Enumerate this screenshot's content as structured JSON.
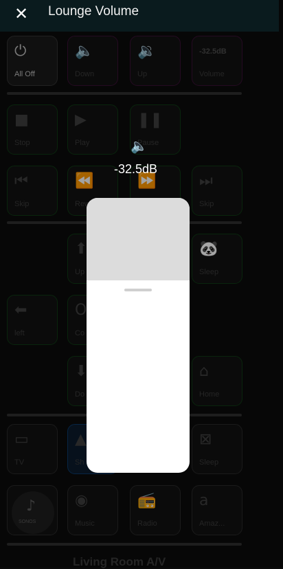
{
  "header": {
    "title": "Lounge Volume",
    "close_icon": "close-icon"
  },
  "volume": {
    "readout": "-32.5dB",
    "icon": "speaker-icon",
    "level_fraction": 0.3,
    "accent_color": "#e8b21a"
  },
  "tiles": {
    "all_off": {
      "label": "All Off",
      "icon": "power-icon"
    },
    "vol_down": {
      "label": "Down",
      "icon": "volume-down-icon"
    },
    "vol_up": {
      "label": "Up",
      "icon": "volume-up-icon"
    },
    "volume": {
      "label": "Volume",
      "value": "-32.5dB"
    },
    "stop": {
      "label": "Stop",
      "icon": "stop-icon"
    },
    "play": {
      "label": "Play",
      "icon": "play-icon"
    },
    "pause": {
      "label": "Pause",
      "icon": "pause-icon"
    },
    "skip_prev": {
      "label": "Skip",
      "icon": "skip-previous-icon"
    },
    "rewind": {
      "label": "Rew",
      "icon": "rewind-icon"
    },
    "fast_forward": {
      "label": "",
      "icon": "fast-forward-icon"
    },
    "skip_next": {
      "label": "Skip",
      "icon": "skip-next-icon"
    },
    "nav_up": {
      "label": "Up",
      "icon": "arrow-up-icon"
    },
    "sleep": {
      "label": "Sleep",
      "icon": "panda-icon"
    },
    "left": {
      "label": "left",
      "icon": "arrow-left-icon"
    },
    "confirm": {
      "label": "Co",
      "icon": "ok-icon"
    },
    "nav_down": {
      "label": "Do",
      "icon": "arrow-down-icon"
    },
    "home": {
      "label": "Home",
      "icon": "home-icon"
    },
    "tv": {
      "label": "TV",
      "icon": "tv-icon"
    },
    "shield": {
      "label": "Sh",
      "icon": "shield-icon"
    },
    "tv_sleep": {
      "label": "Sleep",
      "icon": "tv-off-icon"
    },
    "sonos": {
      "label": "SONOS",
      "icon": "music-note-icon"
    },
    "music": {
      "label": "Music",
      "icon": "spotify-icon"
    },
    "radio": {
      "label": "Radio",
      "icon": "radio-icon"
    },
    "amazon": {
      "label": "Amaz...",
      "icon": "amazon-icon"
    }
  },
  "footer": {
    "title": "Living Room A/V"
  }
}
